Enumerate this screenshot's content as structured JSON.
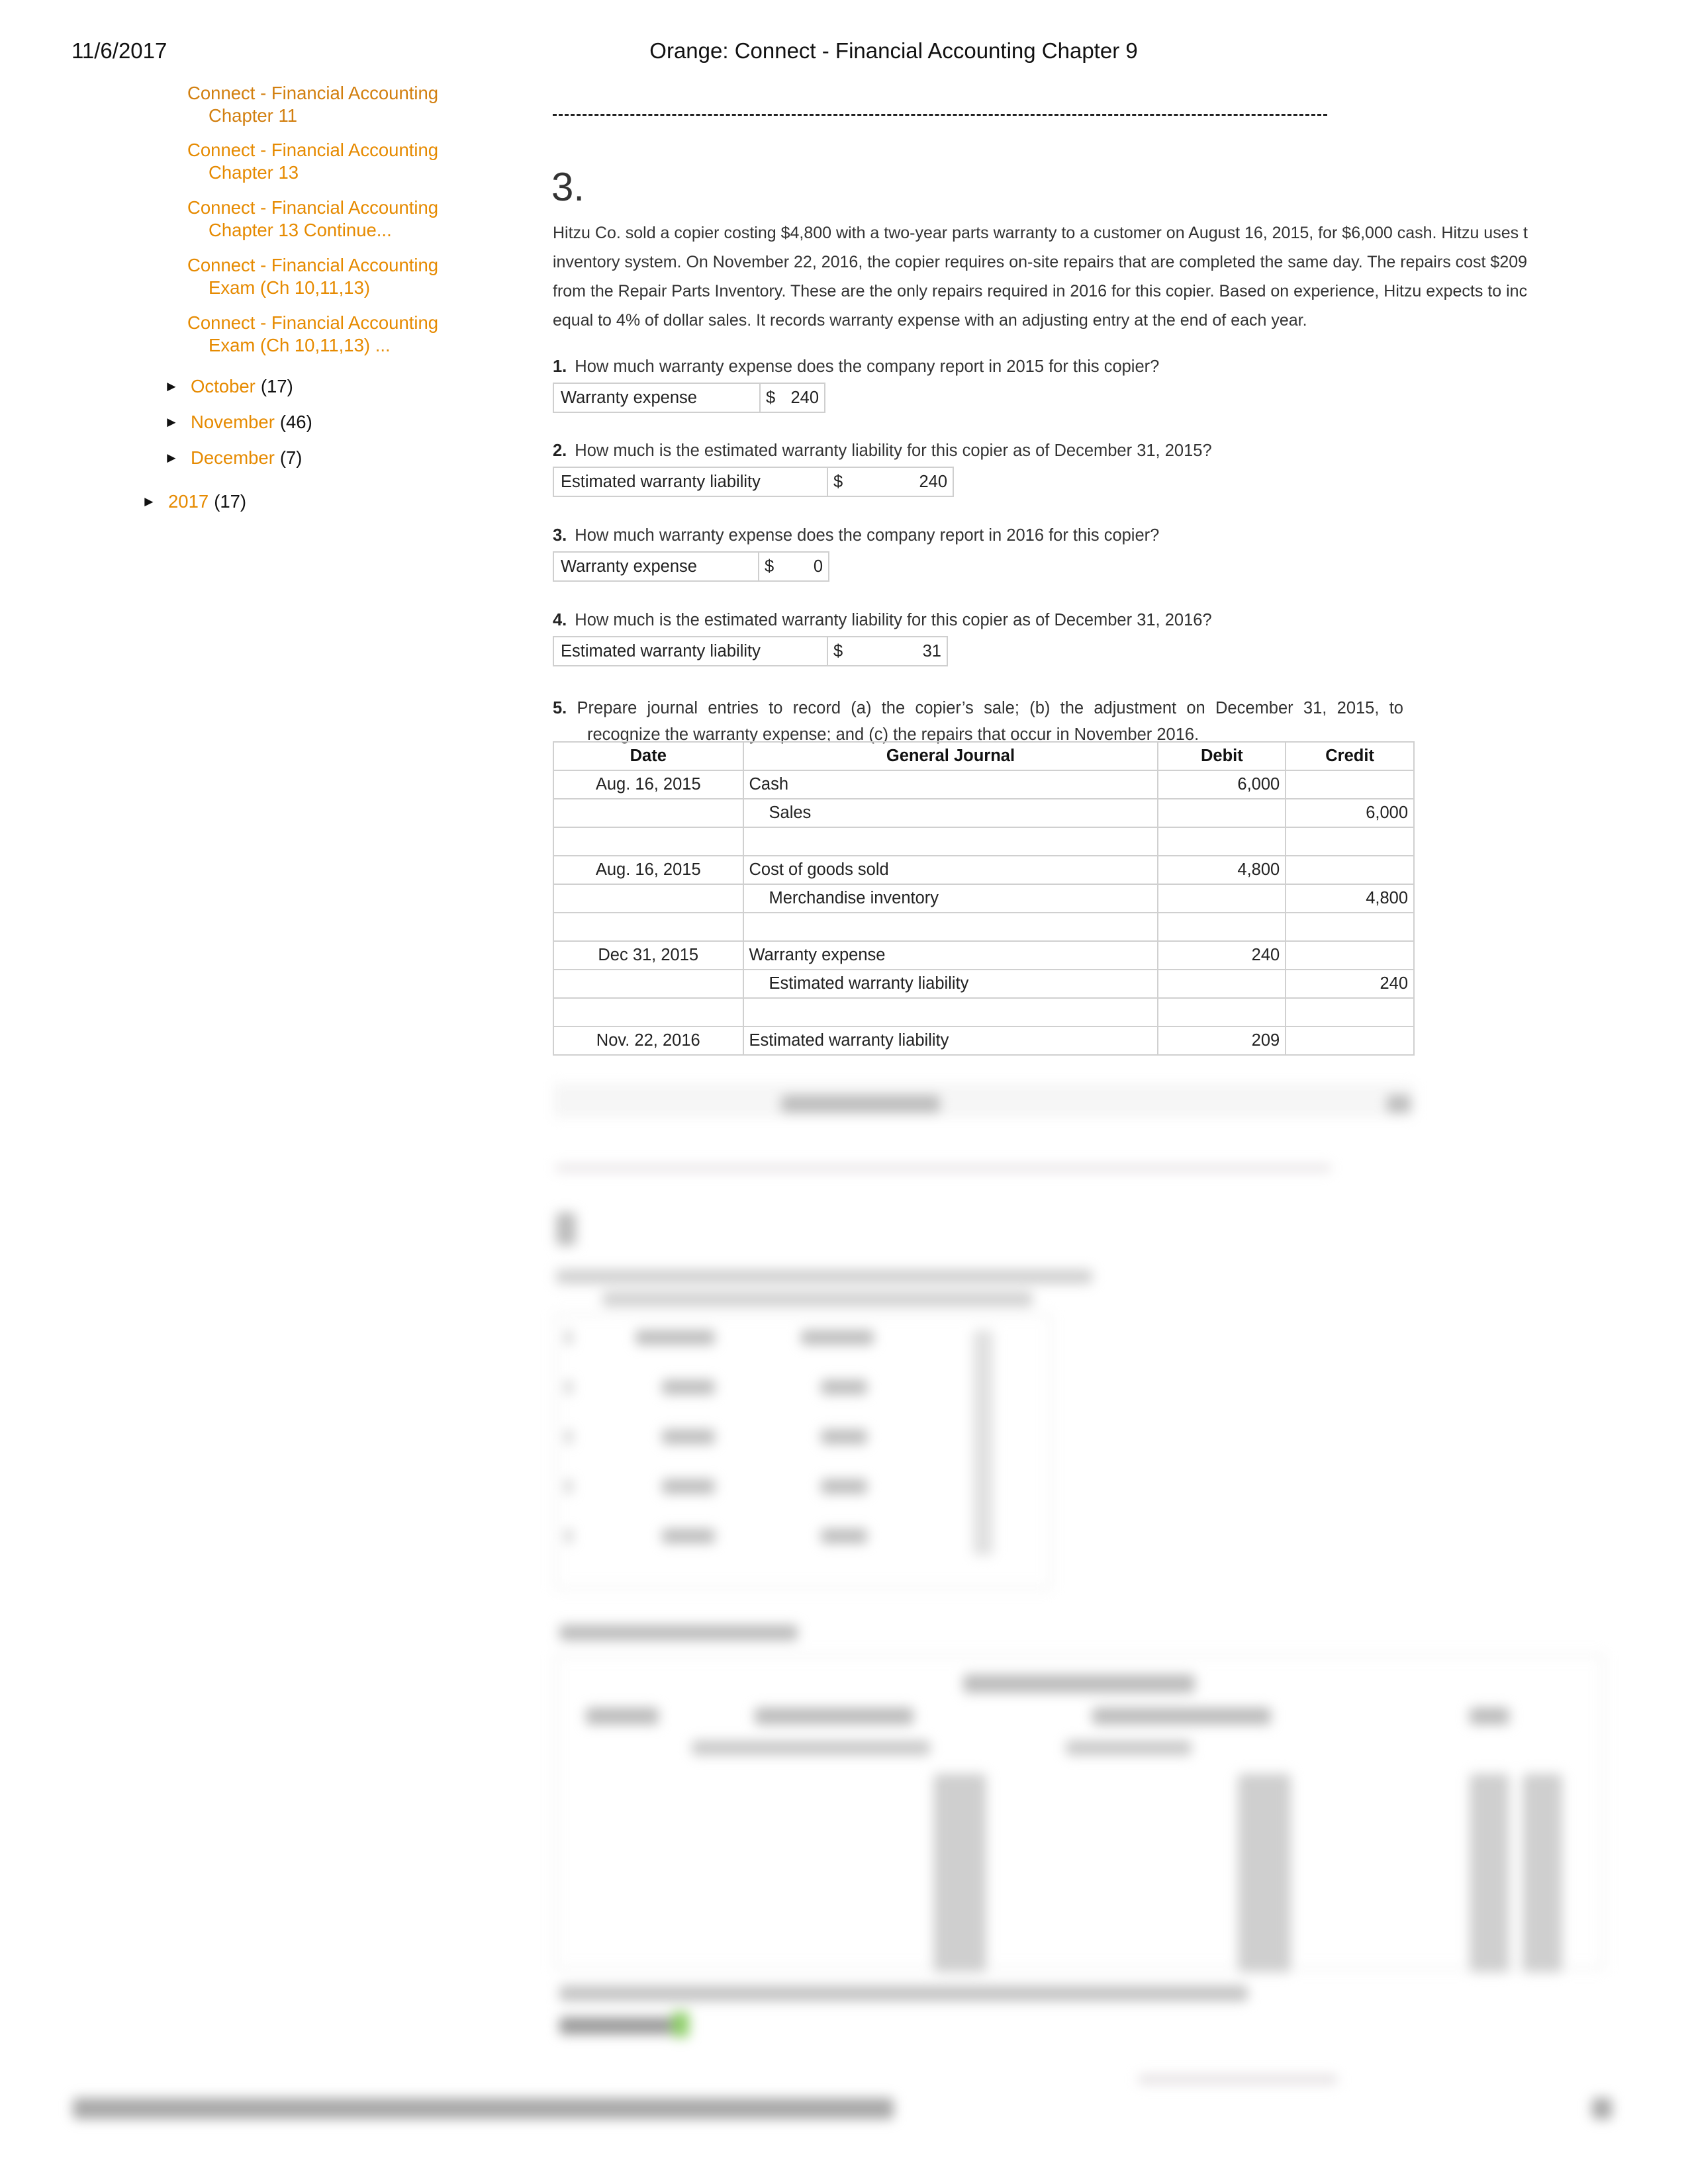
{
  "print_header": {
    "date": "11/6/2017",
    "title": "Orange: Connect - Financial Accounting Chapter 9"
  },
  "sidebar": {
    "posts": [
      {
        "line1": "Connect - Financial Accounting",
        "line2": "Chapter 11"
      },
      {
        "line1": "Connect - Financial Accounting",
        "line2": "Chapter 13"
      },
      {
        "line1": "Connect - Financial Accounting",
        "line2": "Chapter 13 Continue..."
      },
      {
        "line1": "Connect - Financial Accounting",
        "line2": "Exam (Ch 10,11,13)"
      },
      {
        "line1": "Connect - Financial Accounting",
        "line2": "Exam (Ch 10,11,13) ..."
      }
    ],
    "months": [
      {
        "icon": "expand-triangle-icon",
        "label": "October",
        "count": "(17)"
      },
      {
        "icon": "expand-triangle-icon",
        "label": "November",
        "count": "(46)"
      },
      {
        "icon": "expand-triangle-icon",
        "label": "December",
        "count": "(7)"
      }
    ],
    "years": [
      {
        "icon": "expand-triangle-icon",
        "label": "2017",
        "count": "(17)"
      }
    ],
    "link_color": "#e68a00",
    "triangle_glyph": "►"
  },
  "main": {
    "separator": "--------------------------------------------------------------------------------------------------------------------------------",
    "problem_number": "3.",
    "problem_text": [
      "Hitzu Co. sold a copier costing $4,800 with a two-year parts warranty to a customer on August 16, 2015, for $6,000 cash. Hitzu uses t",
      "inventory system. On November 22, 2016, the copier requires on-site repairs that are completed the same day. The repairs cost $209",
      "from the Repair Parts Inventory. These are the only repairs required in 2016 for this copier. Based on experience, Hitzu expects to inc",
      "equal to 4% of dollar sales. It records warranty expense with an adjusting entry at the end of each year."
    ],
    "questions": [
      {
        "num": "1.",
        "text": "How much warranty expense does the company report in 2015 for this copier?",
        "answer_label": "Warranty expense",
        "currency": "$",
        "answer_value": "240"
      },
      {
        "num": "2.",
        "text": "How much is the estimated warranty liability for this copier as of December 31, 2015?",
        "answer_label": "Estimated warranty liability",
        "currency": "$",
        "answer_value": "240"
      },
      {
        "num": "3.",
        "text": "How much warranty expense does the company report in 2016 for this copier?",
        "answer_label": "Warranty expense",
        "currency": "$",
        "answer_value": "0"
      },
      {
        "num": "4.",
        "text": "How much is the estimated warranty liability for this copier as of December 31, 2016?",
        "answer_label": "Estimated warranty liability",
        "currency": "$",
        "answer_value": "31"
      }
    ],
    "q5": {
      "num": "5.",
      "line1_words": [
        "Prepare",
        "journal",
        "entries",
        "to",
        "record",
        "(a)",
        "the",
        "copier’s",
        "sale;",
        "(b)",
        "the",
        "adjustment",
        "on",
        "December",
        "31,",
        "2015,",
        "to"
      ],
      "line2": "recognize the warranty expense; and (c) the repairs that occur in November 2016."
    },
    "journal": {
      "headers": [
        "Date",
        "General Journal",
        "Debit",
        "Credit"
      ],
      "rows": [
        {
          "date": "Aug. 16, 2015",
          "account": "Cash",
          "indent": false,
          "debit": "6,000",
          "credit": ""
        },
        {
          "date": "",
          "account": "Sales",
          "indent": true,
          "debit": "",
          "credit": "6,000"
        },
        {
          "date": "",
          "account": "",
          "indent": false,
          "debit": "",
          "credit": ""
        },
        {
          "date": "Aug. 16, 2015",
          "account": "Cost of goods sold",
          "indent": false,
          "debit": "4,800",
          "credit": ""
        },
        {
          "date": "",
          "account": "Merchandise inventory",
          "indent": true,
          "debit": "",
          "credit": "4,800"
        },
        {
          "date": "",
          "account": "",
          "indent": false,
          "debit": "",
          "credit": ""
        },
        {
          "date": "Dec 31, 2015",
          "account": "Warranty expense",
          "indent": false,
          "debit": "240",
          "credit": ""
        },
        {
          "date": "",
          "account": "Estimated warranty liability",
          "indent": true,
          "debit": "",
          "credit": "240"
        },
        {
          "date": "",
          "account": "",
          "indent": false,
          "debit": "",
          "credit": ""
        },
        {
          "date": "Nov. 22, 2016",
          "account": "Estimated warranty liability",
          "indent": false,
          "debit": "209",
          "credit": ""
        }
      ]
    }
  }
}
